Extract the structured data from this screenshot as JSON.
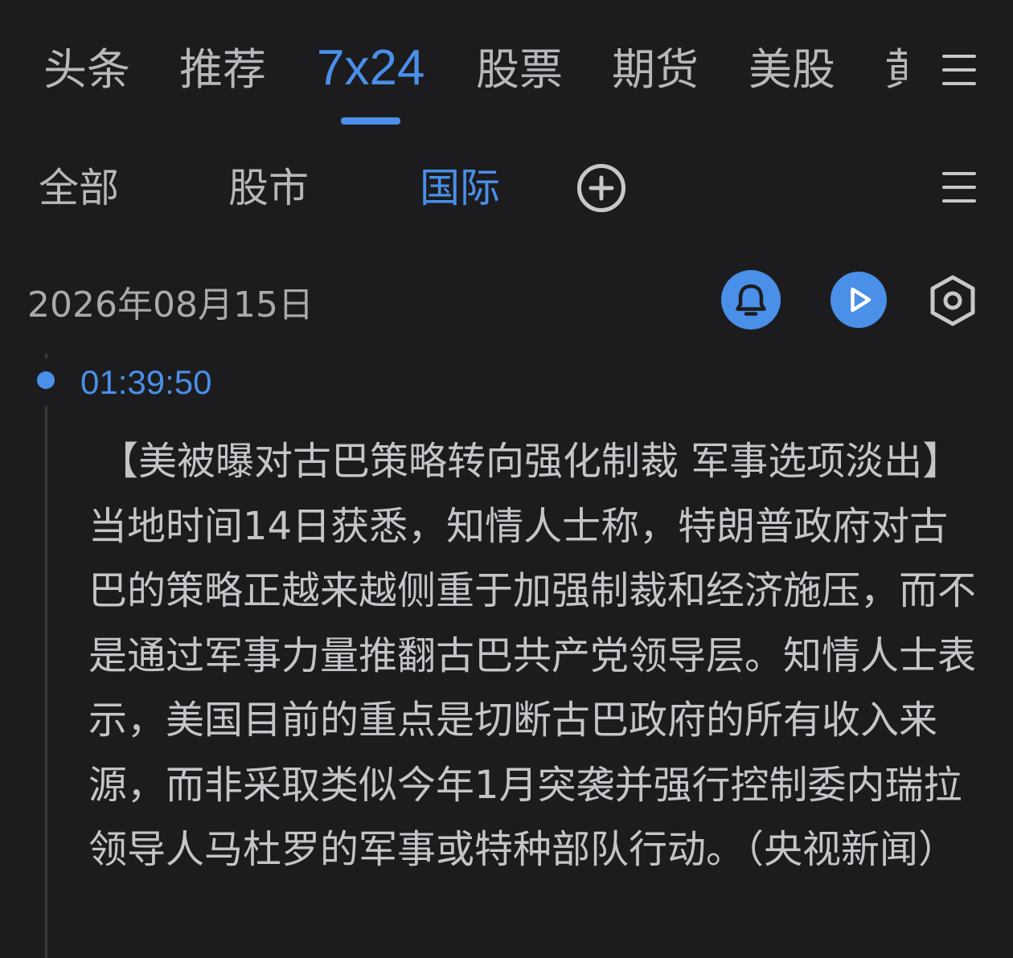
{
  "top_tabs": {
    "items": [
      {
        "label": "头条"
      },
      {
        "label": "推荐"
      },
      {
        "label": "7x24"
      },
      {
        "label": "股票"
      },
      {
        "label": "期货"
      },
      {
        "label": "美股"
      },
      {
        "label": "黄"
      }
    ],
    "active_index": 2
  },
  "sub_tabs": {
    "items": [
      {
        "label": "全部"
      },
      {
        "label": "股市"
      },
      {
        "label": "国际"
      }
    ],
    "active_index": 2
  },
  "date_header": {
    "date": "2026年08月15日"
  },
  "icons": {
    "top_menu": "menu-icon",
    "sub_menu": "menu-icon",
    "add": "plus-circle-icon",
    "bell": "bell-icon",
    "play": "play-icon",
    "settings": "hexagon-settings-icon"
  },
  "news": {
    "time": "01:39:50",
    "content": "【美被曝对古巴策略转向强化制裁 军事选项淡出】当地时间14日获悉，知情人士称，特朗普政府对古巴的策略正越来越侧重于加强制裁和经济施压，而不是通过军事力量推翻古巴共产党领导层。知情人士表示，美国目前的重点是切断古巴政府的所有收入来源，而非采取类似今年1月突袭并强行控制委内瑞拉领导人马杜罗的军事或特种部队行动。（央视新闻）"
  },
  "colors": {
    "background": "#1c1c1e",
    "accent": "#4a8fe8",
    "text": "#c4c4c9",
    "muted": "#a9a9ae"
  }
}
